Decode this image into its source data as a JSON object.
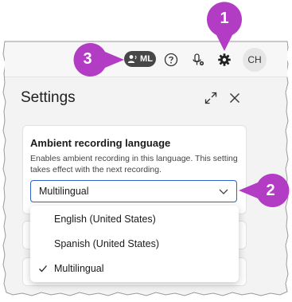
{
  "toolbar": {
    "ml_label": "ML",
    "avatar_initials": "CH"
  },
  "settings": {
    "title": "Settings"
  },
  "ambient": {
    "title": "Ambient recording language",
    "description": "Enables ambient recording in this language. This setting takes effect with the next recording.",
    "selected_value": "Multilingual"
  },
  "dropdown": {
    "options": [
      {
        "label": "English (United States)",
        "checked": false
      },
      {
        "label": "Spanish (United States)",
        "checked": false
      },
      {
        "label": "Multilingual",
        "checked": true
      }
    ]
  },
  "callouts": {
    "one": "1",
    "two": "2",
    "three": "3"
  },
  "colors": {
    "callout": "#b23cc4",
    "accent": "#2c63c7",
    "pill": "#474747"
  }
}
